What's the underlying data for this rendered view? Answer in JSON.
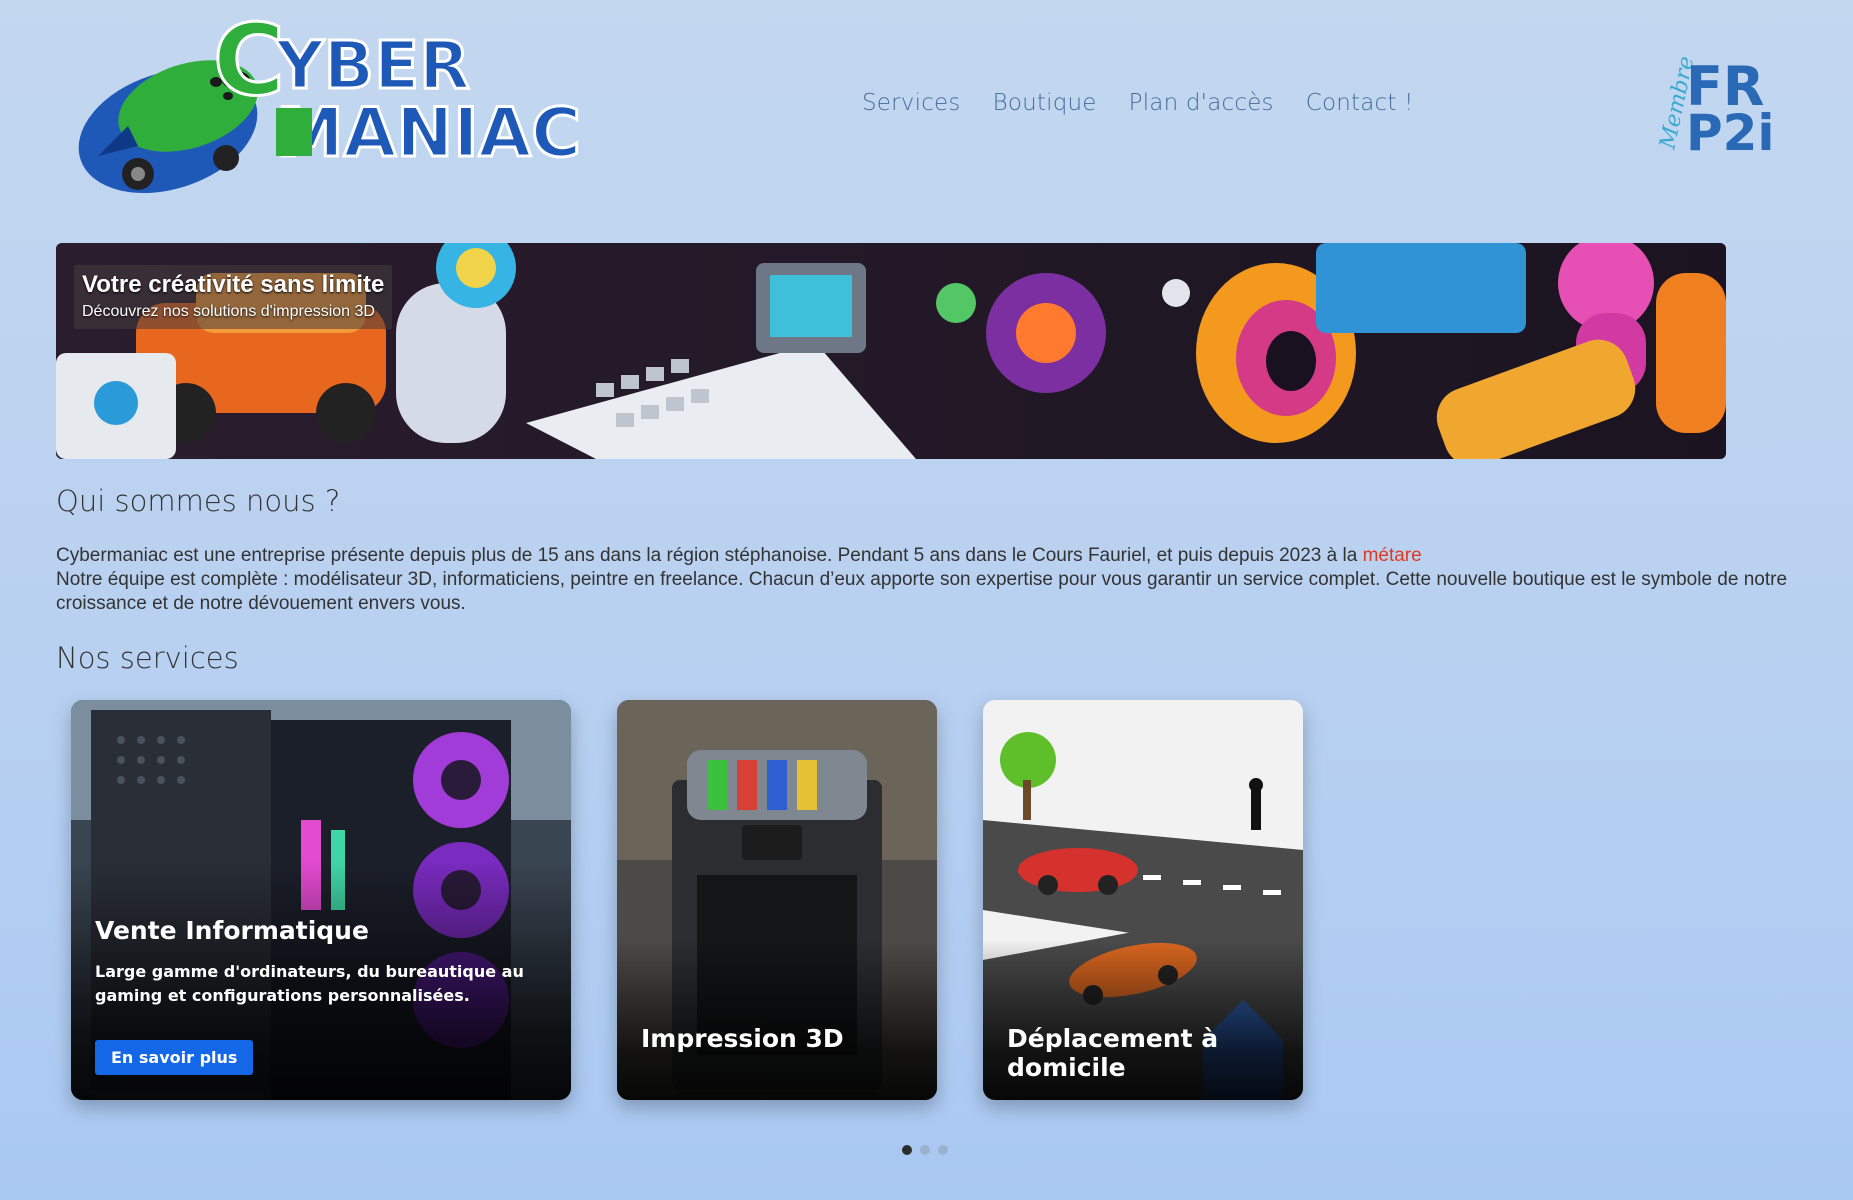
{
  "header": {
    "logo_line1": "YBER",
    "logo_c": "C",
    "logo_line2": "MANIAC",
    "nav": [
      {
        "label": "Services"
      },
      {
        "label": "Boutique"
      },
      {
        "label": "Plan d'accès"
      },
      {
        "label": "Contact !"
      }
    ],
    "badge_script": "Membre",
    "badge_line1": "FR",
    "badge_line2": "P2i"
  },
  "hero": {
    "title": "Votre créativité sans limite",
    "subtitle": "Découvrez nos solutions d'impression 3D"
  },
  "about": {
    "title": "Qui sommes nous ?",
    "line1": "Cybermaniac est une entreprise présente depuis plus de 15 ans dans la région stéphanoise. Pendant 5 ans dans le Cours Fauriel, et puis depuis 2023 à la ",
    "link": "métare",
    "line2": "Notre équipe est complète : modélisateur 3D, informaticiens, peintre en freelance. Chacun d’eux apporte son expertise pour vous garantir un service complet. Cette nouvelle boutique est le symbole de notre croissance et de notre dévouement envers vous."
  },
  "services": {
    "title": "Nos services",
    "cards": [
      {
        "title": "Vente Informatique",
        "description": "Large gamme d'ordinateurs, du bureautique au gaming et configurations personnalisées.",
        "button": "En savoir plus"
      },
      {
        "title": "Impression 3D"
      },
      {
        "title": "Déplacement à domicile"
      }
    ],
    "carousel_active": 1,
    "carousel_count": 3
  },
  "colors": {
    "background": "#bcd3f0",
    "nav_text": "#456b9b",
    "link": "#e03a1d",
    "button": "#1467e6"
  }
}
